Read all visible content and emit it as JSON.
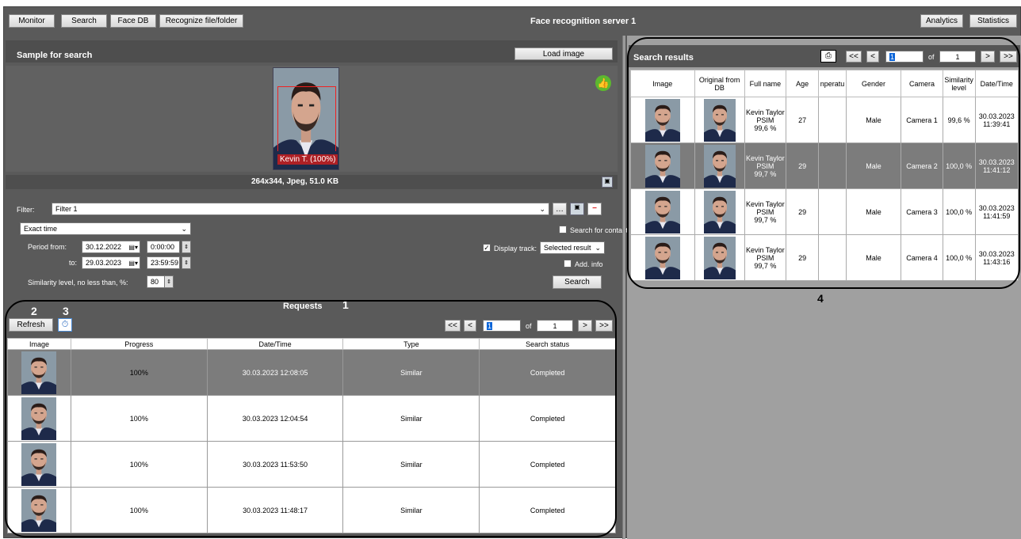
{
  "toolbar": {
    "monitor": "Monitor",
    "search": "Search",
    "face_db": "Face DB",
    "recognize": "Recognize file/folder",
    "title": "Face recognition server 1",
    "analytics": "Analytics",
    "statistics": "Statistics"
  },
  "sample": {
    "title": "Sample for search",
    "load_image": "Load image",
    "face_label": "Kevin T. (100%)",
    "image_info": "264x344, Jpeg, 51.0 KB"
  },
  "filter": {
    "label": "Filter:",
    "value": "Filter 1",
    "time_mode": "Exact time",
    "period_from_label": "Period from:",
    "from_date": "30.12.2022",
    "from_time": "0:00:00",
    "to_label": "to:",
    "to_date": "29.03.2023",
    "to_time": "23:59:59",
    "similarity_label": "Similarity level, no less than, %:",
    "similarity_value": "80",
    "search_contacts": "Search for contacts",
    "display_track": "Display track:",
    "display_track_value": "Selected result",
    "add_info": "Add. info",
    "search_button": "Search"
  },
  "requests": {
    "title": "Requests",
    "refresh": "Refresh",
    "page": "1",
    "of": "of",
    "total": "1",
    "first": "<<",
    "prev": "<",
    "next": ">",
    "last": ">>",
    "columns": [
      "Image",
      "Progress",
      "Date/Time",
      "Type",
      "Search status"
    ],
    "rows": [
      {
        "progress": "100%",
        "datetime": "30.03.2023 12:08:05",
        "type": "Similar",
        "status": "Completed"
      },
      {
        "progress": "100%",
        "datetime": "30.03.2023 12:04:54",
        "type": "Similar",
        "status": "Completed"
      },
      {
        "progress": "100%",
        "datetime": "30.03.2023 11:53:50",
        "type": "Similar",
        "status": "Completed"
      },
      {
        "progress": "100%",
        "datetime": "30.03.2023 11:48:17",
        "type": "Similar",
        "status": "Completed"
      }
    ]
  },
  "results": {
    "title": "Search results",
    "page": "1",
    "of": "of",
    "total": "1",
    "first": "<<",
    "prev": "<",
    "next": ">",
    "last": ">>",
    "columns": [
      "Image",
      "Original from DB",
      "Full name",
      "Age",
      "nperatu",
      "Gender",
      "Camera",
      "Similarity level",
      "Date/Time"
    ],
    "rows": [
      {
        "name": "Kevin Taylor",
        "group": "PSIM",
        "score": "99,6 %",
        "age": "27",
        "gender": "Male",
        "camera": "Camera 1",
        "similarity": "99,6 %",
        "date": "30.03.2023",
        "time": "11:39:41"
      },
      {
        "name": "Kevin Taylor",
        "group": "PSIM",
        "score": "99,7 %",
        "age": "29",
        "gender": "Male",
        "camera": "Camera 2",
        "similarity": "100,0 %",
        "date": "30.03.2023",
        "time": "11:41:12"
      },
      {
        "name": "Kevin Taylor",
        "group": "PSIM",
        "score": "99,7 %",
        "age": "29",
        "gender": "Male",
        "camera": "Camera 3",
        "similarity": "100,0 %",
        "date": "30.03.2023",
        "time": "11:41:59"
      },
      {
        "name": "Kevin Taylor",
        "group": "PSIM",
        "score": "99,7 %",
        "age": "29",
        "gender": "Male",
        "camera": "Camera 4",
        "similarity": "100,0 %",
        "date": "30.03.2023",
        "time": "11:43:16"
      }
    ]
  },
  "annotations": {
    "a1": "1",
    "a2": "2",
    "a3": "3",
    "a4": "4"
  },
  "colors": {
    "panel": "#5a5a5a",
    "selected_row": "#7c7c7c",
    "accent_green": "#5cb82f"
  }
}
